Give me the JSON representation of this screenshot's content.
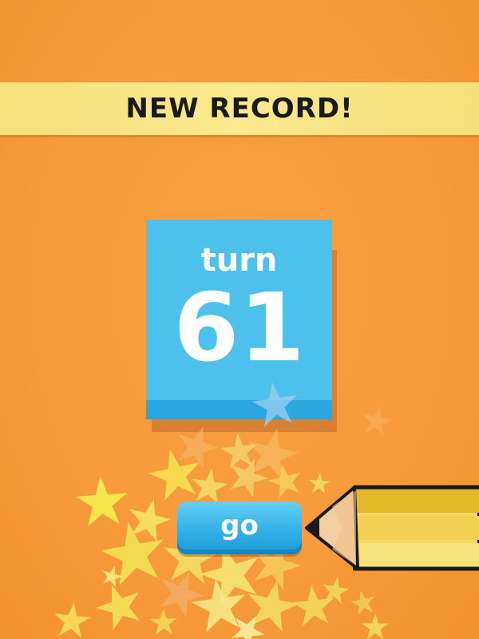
{
  "banner": {
    "text": "NEW RECORD!"
  },
  "turn_card": {
    "label": "turn",
    "number": "61"
  },
  "go_button": {
    "label": "go"
  },
  "colors": {
    "background": "#f79b3c",
    "banner": "#fbe98f",
    "card": "#4ec0ec",
    "button": "#2eaee6",
    "pencil_body": "#f5dc63"
  },
  "decorations": {
    "stars": "star-burst",
    "pencil": "pencil-icon"
  }
}
